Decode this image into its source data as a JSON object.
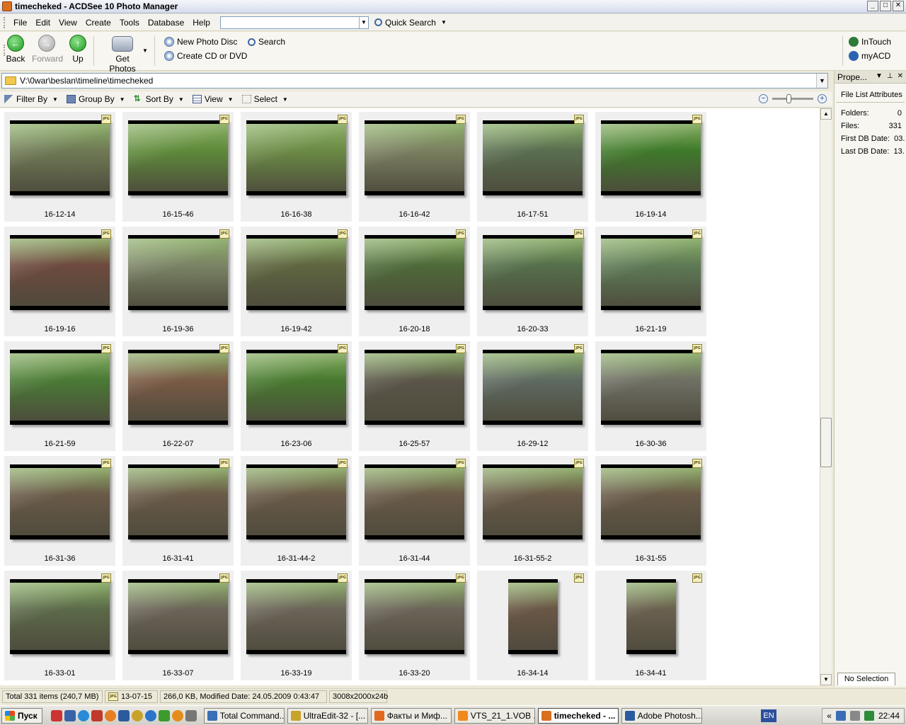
{
  "window": {
    "title": "timecheked - ACDSee 10 Photo Manager"
  },
  "menu": {
    "items": [
      "File",
      "Edit",
      "View",
      "Create",
      "Tools",
      "Database",
      "Help"
    ],
    "quick_search": "Quick Search"
  },
  "toolbar": {
    "back": "Back",
    "forward": "Forward",
    "up": "Up",
    "get_photos": "Get Photos",
    "new_photo_disc": "New Photo Disc",
    "create_cd": "Create CD or DVD",
    "search": "Search",
    "intouch": "InTouch",
    "myacd": "myACD"
  },
  "address": {
    "path": "V:\\0war\\beslan\\timeline\\timecheked"
  },
  "filterbar": {
    "filter_by": "Filter By",
    "group_by": "Group By",
    "sort_by": "Sort By",
    "view": "View",
    "select": "Select"
  },
  "thumb_badge": "JPG",
  "thumbnails": [
    {
      "name": "16-12-14",
      "color": "#6f7a55"
    },
    {
      "name": "16-15-46",
      "color": "#5e8a3a"
    },
    {
      "name": "16-16-38",
      "color": "#6b8a45"
    },
    {
      "name": "16-16-42",
      "color": "#7a8060"
    },
    {
      "name": "16-17-51",
      "color": "#5a6e50"
    },
    {
      "name": "16-19-14",
      "color": "#3f7a2a"
    },
    {
      "name": "16-19-16",
      "color": "#6e4a3e"
    },
    {
      "name": "16-19-36",
      "color": "#7b8465"
    },
    {
      "name": "16-19-42",
      "color": "#5f6640"
    },
    {
      "name": "16-20-18",
      "color": "#4e6a3a"
    },
    {
      "name": "16-20-33",
      "color": "#55704a"
    },
    {
      "name": "16-21-19",
      "color": "#5e7a55"
    },
    {
      "name": "16-21-59",
      "color": "#4a7a35"
    },
    {
      "name": "16-22-07",
      "color": "#7a5a45"
    },
    {
      "name": "16-23-06",
      "color": "#487a30"
    },
    {
      "name": "16-25-57",
      "color": "#5a5548"
    },
    {
      "name": "16-29-12",
      "color": "#5e6a60"
    },
    {
      "name": "16-30-36",
      "color": "#707065"
    },
    {
      "name": "16-31-36",
      "color": "#6a5a48"
    },
    {
      "name": "16-31-41",
      "color": "#6a5a48"
    },
    {
      "name": "16-31-44-2",
      "color": "#6a5a48"
    },
    {
      "name": "16-31-44",
      "color": "#6a5a48"
    },
    {
      "name": "16-31-55-2",
      "color": "#6a5a48"
    },
    {
      "name": "16-31-55",
      "color": "#6a5a48"
    },
    {
      "name": "16-33-01",
      "color": "#5b6a48"
    },
    {
      "name": "16-33-07",
      "color": "#6b6458"
    },
    {
      "name": "16-33-19",
      "color": "#6b6458"
    },
    {
      "name": "16-33-20",
      "color": "#6b6458"
    },
    {
      "name": "16-34-14",
      "color": "#6a5646",
      "portrait": true
    },
    {
      "name": "16-34-41",
      "color": "#6a6050",
      "portrait": true
    }
  ],
  "sidepane": {
    "title": "Prope...",
    "header": "File List Attributes",
    "rows": [
      {
        "label": "Folders:",
        "value": "0"
      },
      {
        "label": "Files:",
        "value": "331"
      },
      {
        "label": "First DB Date:",
        "value": "03."
      },
      {
        "label": "Last DB Date:",
        "value": "13."
      }
    ],
    "tab": "No Selection"
  },
  "status": {
    "total": "Total 331 items  (240,7 MB)",
    "file": "13-07-15",
    "info": "266,0 KB, Modified Date: 24.05.2009 0:43:47",
    "dims": "3008x2000x24b"
  },
  "taskbar": {
    "start": "Пуск",
    "tasks": [
      {
        "label": "Total Command...",
        "color": "#3a6fb5"
      },
      {
        "label": "UltraEdit-32 - [...",
        "color": "#c9a22a"
      },
      {
        "label": "Факты и Миф...",
        "color": "#e2681f"
      },
      {
        "label": "VTS_21_1.VOB ...",
        "color": "#f08a1c"
      },
      {
        "label": "timecheked - ...",
        "color": "#d9701f",
        "active": true
      },
      {
        "label": "Adobe Photosh...",
        "color": "#2c5a9e"
      }
    ],
    "lang": "EN",
    "clock": "22:44"
  }
}
